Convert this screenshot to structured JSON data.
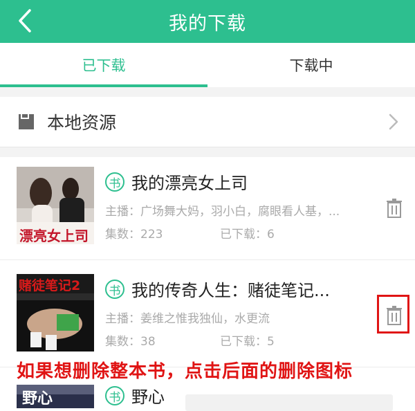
{
  "header": {
    "title": "我的下载",
    "back_icon": "chevron-left-icon"
  },
  "tabs": [
    {
      "label": "已下载",
      "active": true
    },
    {
      "label": "下载中",
      "active": false
    }
  ],
  "local": {
    "label": "本地资源",
    "icon": "sd-card-icon"
  },
  "items": [
    {
      "badge": "书",
      "title": "我的漂亮女上司",
      "anchors": "主播：广场舞大妈，羽小白，腐眼看人基，...",
      "count": "集数：223",
      "downloaded": "已下载：6",
      "cover_text": "漂亮女上司"
    },
    {
      "badge": "书",
      "title": "我的传奇人生：赌徒笔记...",
      "anchors": "主播：姜维之惟我独仙，水更流",
      "count": "集数：38",
      "downloaded": "已下载：5",
      "cover_text": "赌徒笔记2"
    },
    {
      "badge": "书",
      "title": "野心",
      "cover_text": "野心"
    }
  ],
  "annotation": "如果想删除整本书，点击后面的删除图标",
  "colors": {
    "accent": "#2dbf8f",
    "annotation": "#e01414"
  }
}
